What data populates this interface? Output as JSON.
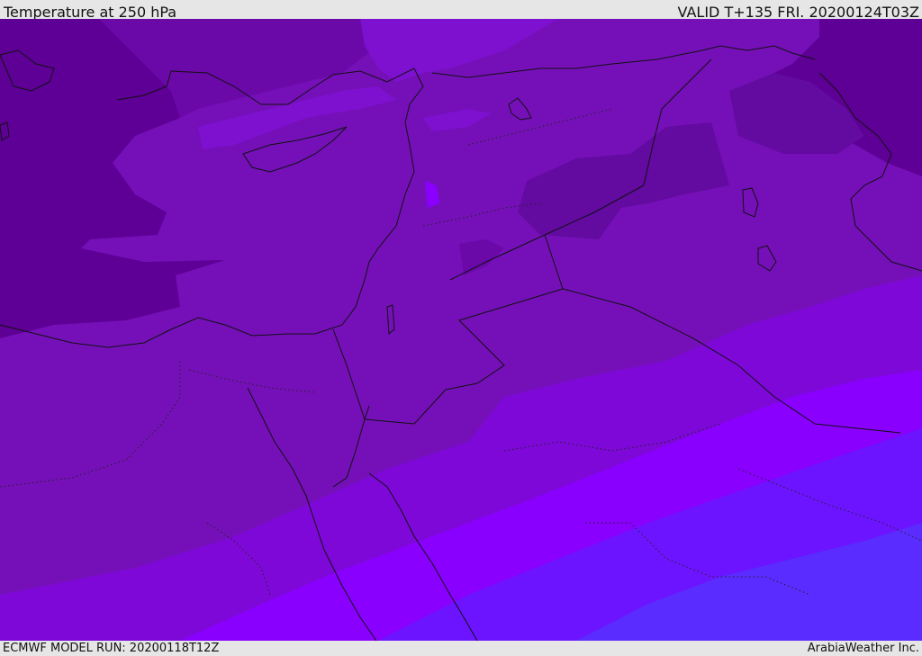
{
  "header": {
    "title": "Temperature at 250 hPa",
    "valid_label": "VALID T+135 FRI. 20200124T03Z"
  },
  "footer": {
    "model_run": "ECMWF MODEL RUN: 20200118T12Z",
    "credit": "ArabiaWeather Inc."
  },
  "colors": {
    "band_darkest": "#5e0096",
    "band_dark": "#6a08a8",
    "band_mid": "#7510b8",
    "band_violet": "#7e08d8",
    "band_bright": "#8a00ff",
    "band_blue": "#6c14ff",
    "band_bluest": "#5a2cff",
    "coastline": "#111111"
  }
}
